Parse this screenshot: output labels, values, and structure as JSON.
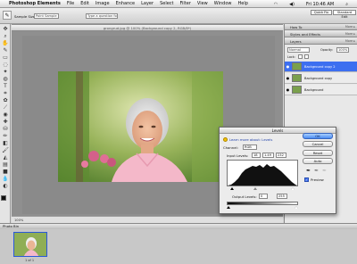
{
  "menubar": {
    "app": "Photoshop Elements",
    "items": [
      "File",
      "Edit",
      "Image",
      "Enhance",
      "Layer",
      "Select",
      "Filter",
      "View",
      "Window",
      "Help"
    ],
    "clock": "Fri 10:46 AM"
  },
  "options": {
    "sample_label": "Sample Size:",
    "sample_value": "Point Sample",
    "question_placeholder": "Type a question for help",
    "quickfix": "Quick Fix",
    "standard_edit": "Standard Edit"
  },
  "document": {
    "title": "grongrud.jpg @ 100% (Background copy 2, RGB/8*)",
    "status": "100%"
  },
  "palettes": {
    "how_to": "How To",
    "styles": "Styles and Effects",
    "layers": "Layers",
    "more": "More ▸",
    "blend_mode": "Normal",
    "opacity_label": "Opacity:",
    "opacity_value": "100%",
    "lock_label": "Lock:",
    "layer_names": [
      "Background copy 2",
      "Background copy",
      "Background"
    ]
  },
  "photobin": {
    "title": "Photo Bin",
    "footer": "1 of 1"
  },
  "levels": {
    "title": "Levels",
    "learn_more": "Learn more about: Levels",
    "channel_label": "Channel:",
    "channel_value": "RGB",
    "input_label": "Input Levels:",
    "input_black": "18",
    "input_gamma": "1.49",
    "input_white": "232",
    "output_label": "Output Levels:",
    "output_black": "0",
    "output_white": "255",
    "ok": "OK",
    "cancel": "Cancel",
    "reset": "Reset",
    "auto": "Auto",
    "preview": "Preview"
  }
}
